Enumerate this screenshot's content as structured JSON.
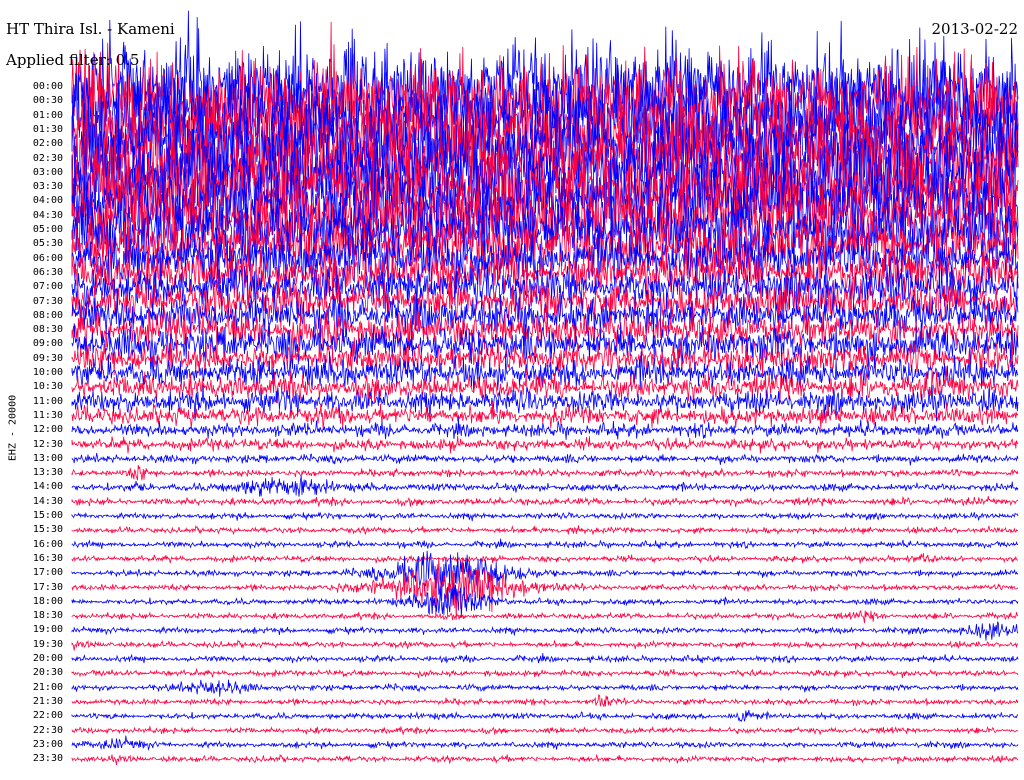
{
  "header": {
    "station": "HT Thira Isl. - Kameni",
    "date": "2013-02-22",
    "filter_label": "Applied filter: 0.5"
  },
  "chart_data": {
    "type": "helicorder",
    "channel_label": "EHZ - 20000",
    "row_times": [
      "00:00",
      "00:30",
      "01:00",
      "01:30",
      "02:00",
      "02:30",
      "03:00",
      "03:30",
      "04:00",
      "04:30",
      "05:00",
      "05:30",
      "06:00",
      "06:30",
      "07:00",
      "07:30",
      "08:00",
      "08:30",
      "09:00",
      "09:30",
      "10:00",
      "10:30",
      "11:00",
      "11:30",
      "12:00",
      "12:30",
      "13:00",
      "13:30",
      "14:00",
      "14:30",
      "15:00",
      "15:30",
      "16:00",
      "16:30",
      "17:00",
      "17:30",
      "18:00",
      "18:30",
      "19:00",
      "19:30",
      "20:00",
      "20:30",
      "21:00",
      "21:30",
      "22:00",
      "22:30",
      "23:00",
      "23:30"
    ],
    "row_colors": [
      "#0000ff",
      "#ff0040"
    ],
    "relative_amplitude": [
      0.68,
      0.66,
      0.67,
      0.65,
      0.63,
      0.64,
      0.62,
      0.6,
      0.58,
      0.56,
      0.48,
      0.42,
      0.36,
      0.32,
      0.28,
      0.27,
      0.26,
      0.25,
      0.25,
      0.22,
      0.2,
      0.18,
      0.16,
      0.13,
      0.09,
      0.08,
      0.055,
      0.05,
      0.05,
      0.05,
      0.04,
      0.04,
      0.04,
      0.04,
      0.04,
      0.04,
      0.04,
      0.04,
      0.04,
      0.04,
      0.04,
      0.04,
      0.04,
      0.04,
      0.04,
      0.04,
      0.04,
      0.04
    ],
    "events": [
      {
        "time": "13:30",
        "position": 0.07,
        "amplitude": 0.8,
        "duration": 0.008
      },
      {
        "time": "14:00",
        "position": 0.07,
        "amplitude": 0.5,
        "duration": 0.006
      },
      {
        "time": "14:00",
        "position": 0.2,
        "amplitude": 0.9,
        "duration": 0.03
      },
      {
        "time": "14:00",
        "position": 0.25,
        "amplitude": 0.8,
        "duration": 0.025
      },
      {
        "time": "15:30",
        "position": 0.53,
        "amplitude": 0.4,
        "duration": 0.012
      },
      {
        "time": "16:30",
        "position": 0.9,
        "amplitude": 0.4,
        "duration": 0.012
      },
      {
        "time": "17:00",
        "position": 0.4,
        "amplitude": 2.6,
        "duration": 0.06
      },
      {
        "time": "17:30",
        "position": 0.32,
        "amplitude": 0.6,
        "duration": 0.04
      },
      {
        "time": "17:30",
        "position": 0.4,
        "amplitude": 3.0,
        "duration": 0.05
      },
      {
        "time": "17:30",
        "position": 0.47,
        "amplitude": 0.6,
        "duration": 0.04
      },
      {
        "time": "18:00",
        "position": 0.4,
        "amplitude": 1.8,
        "duration": 0.035
      },
      {
        "time": "18:30",
        "position": 0.84,
        "amplitude": 0.5,
        "duration": 0.012
      },
      {
        "time": "19:00",
        "position": 0.97,
        "amplitude": 0.9,
        "duration": 0.025
      },
      {
        "time": "21:00",
        "position": 0.15,
        "amplitude": 0.7,
        "duration": 0.035
      },
      {
        "time": "21:30",
        "position": 0.56,
        "amplitude": 0.6,
        "duration": 0.01
      },
      {
        "time": "22:00",
        "position": 0.71,
        "amplitude": 0.9,
        "duration": 0.01
      },
      {
        "time": "23:00",
        "position": 0.05,
        "amplitude": 0.4,
        "duration": 0.03
      }
    ]
  }
}
